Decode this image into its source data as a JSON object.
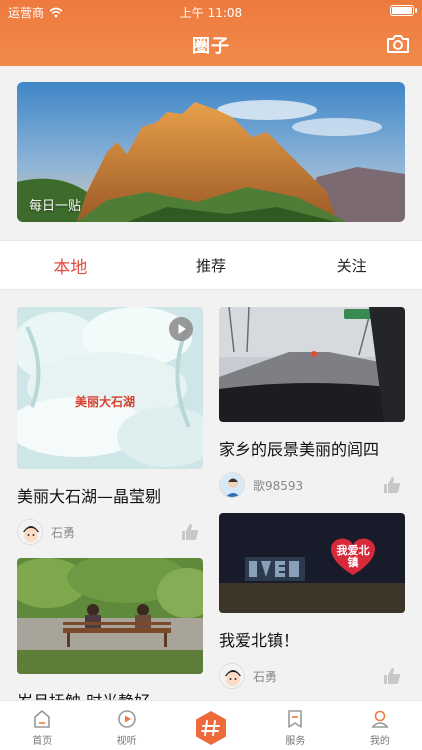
{
  "status": {
    "carrier": "运营商",
    "time": "上午 11:08"
  },
  "header": {
    "title": "圈子",
    "camera_icon": "camera-icon"
  },
  "banner": {
    "label": "每日一贴"
  },
  "tabs": [
    {
      "label": "本地",
      "active": true
    },
    {
      "label": "推荐",
      "active": false
    },
    {
      "label": "关注",
      "active": false
    }
  ],
  "posts": [
    {
      "caption": "美丽大石湖—晶莹剔",
      "author": "石勇",
      "image_text": "美丽大石湖",
      "has_video": true
    },
    {
      "caption": "家乡的辰景美丽的闾四",
      "author": "歌98593"
    },
    {
      "caption": "我爱北镇！",
      "author": "石勇",
      "image_text": "我爱北镇"
    },
    {
      "caption": "岁月抚触 时光静好"
    }
  ],
  "tabbar": [
    {
      "label": "首页",
      "icon": "home-icon"
    },
    {
      "label": "视听",
      "icon": "play-icon"
    },
    {
      "label": "",
      "icon": "hash-icon"
    },
    {
      "label": "服务",
      "icon": "bookmark-icon"
    },
    {
      "label": "我的",
      "icon": "user-icon"
    }
  ],
  "colors": {
    "accent": "#ee7a3e",
    "active_tab": "#e8473e"
  }
}
